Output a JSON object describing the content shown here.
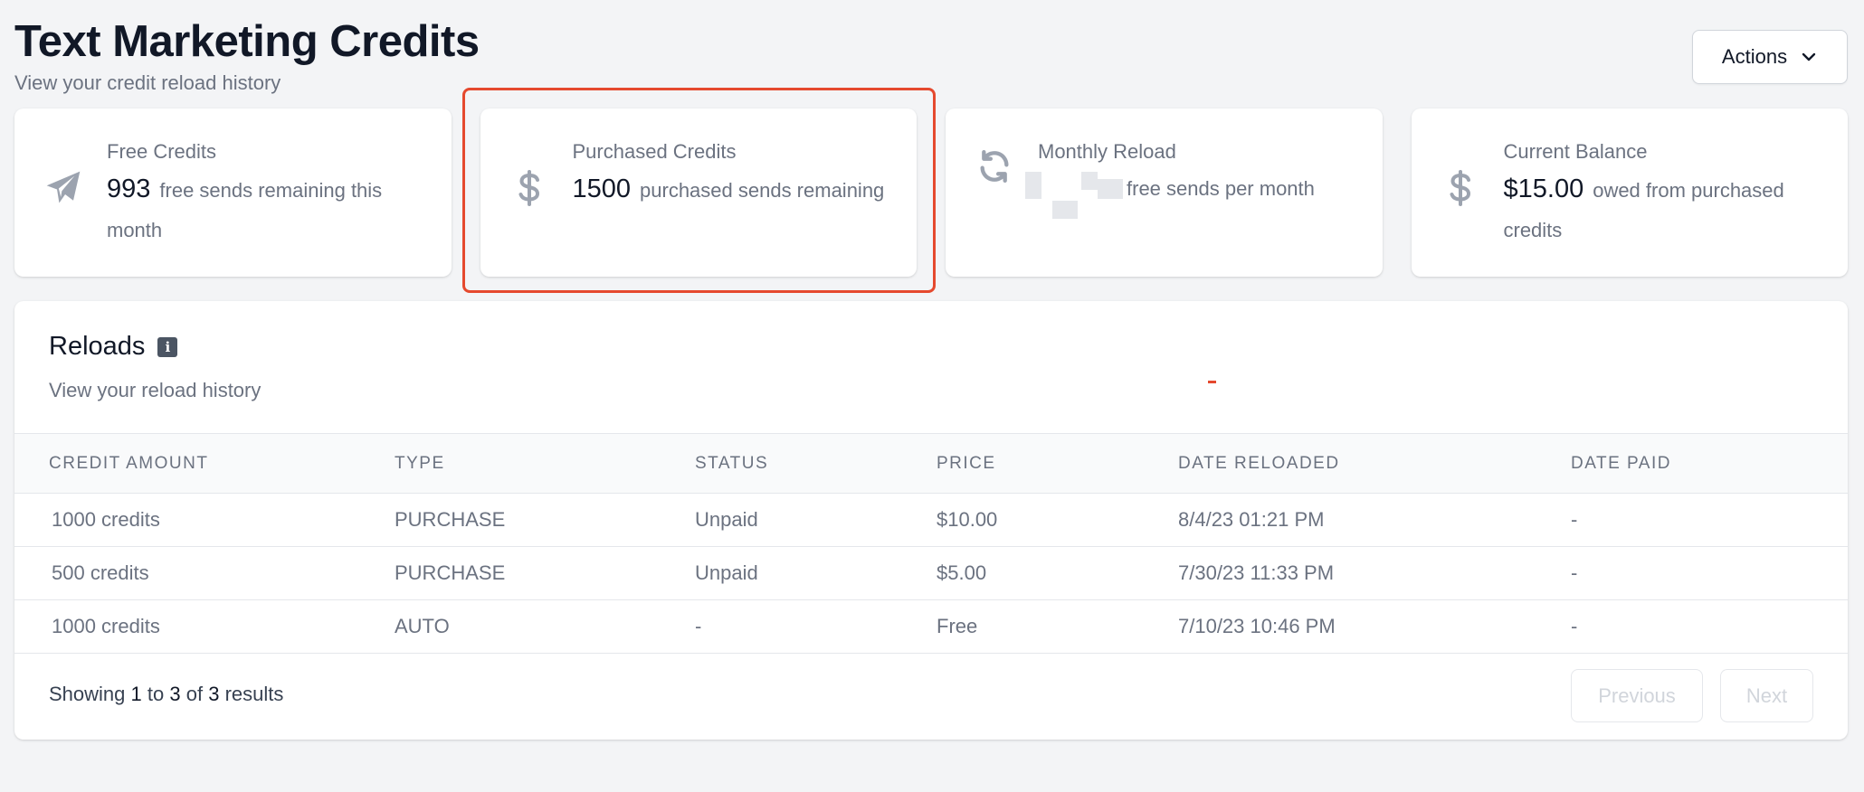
{
  "header": {
    "title": "Text Marketing Credits",
    "subtitle": "View your credit reload history",
    "actions_label": "Actions"
  },
  "cards": [
    {
      "icon": "paper-plane-icon",
      "label": "Free Credits",
      "value": "993",
      "description": "free sends remaining this month"
    },
    {
      "icon": "dollar-icon",
      "label": "Purchased Credits",
      "value": "1500",
      "description": "purchased sends remaining"
    },
    {
      "icon": "refresh-icon",
      "label": "Monthly Reload",
      "value": "",
      "description": "free sends per month"
    },
    {
      "icon": "dollar-icon",
      "label": "Current Balance",
      "value": "$15.00",
      "description": "owed from purchased credits"
    }
  ],
  "reloads": {
    "title": "Reloads",
    "subtitle": "View your reload history",
    "columns": [
      "CREDIT AMOUNT",
      "TYPE",
      "STATUS",
      "PRICE",
      "DATE RELOADED",
      "DATE PAID"
    ],
    "rows": [
      [
        "1000 credits",
        "PURCHASE",
        "Unpaid",
        "$10.00",
        "8/4/23 01:21 PM",
        "-"
      ],
      [
        "500 credits",
        "PURCHASE",
        "Unpaid",
        "$5.00",
        "7/30/23 11:33 PM",
        "-"
      ],
      [
        "1000 credits",
        "AUTO",
        "-",
        "Free",
        "7/10/23 10:46 PM",
        "-"
      ]
    ],
    "footer": {
      "showing": "Showing",
      "from": "1",
      "to_word": "to",
      "to": "3",
      "of_word": "of",
      "total": "3",
      "results_word": "results",
      "previous_label": "Previous",
      "next_label": "Next"
    }
  },
  "colors": {
    "highlight": "#e5492e",
    "icon": "#9ca3af",
    "muted_text": "#6b7280"
  }
}
